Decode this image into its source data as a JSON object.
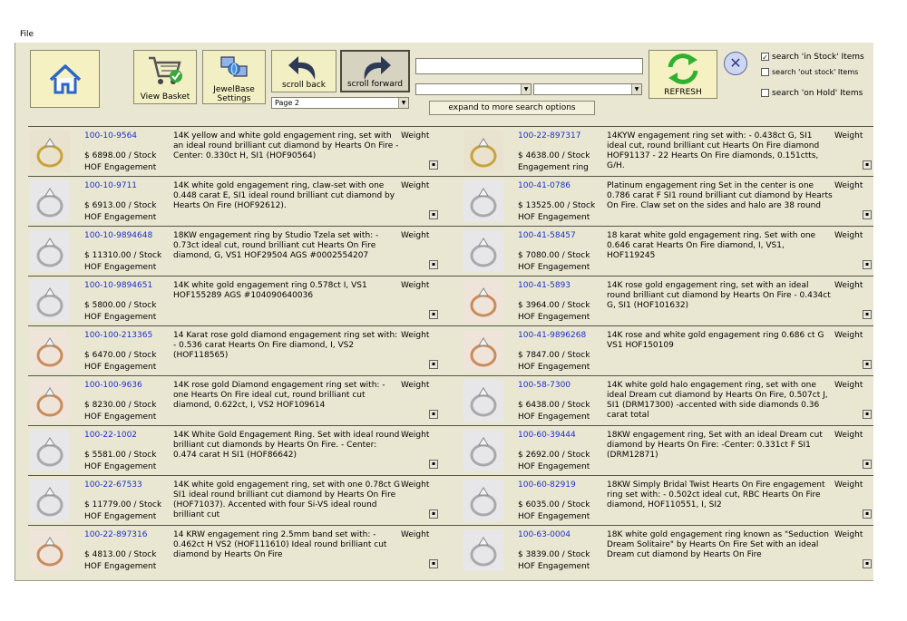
{
  "menu": {
    "file": "File"
  },
  "toolbar": {
    "view_basket": "View Basket",
    "jewelbase_settings": "JewelBase Settings",
    "scroll_back": "scroll back",
    "scroll_forward": "scroll forward",
    "page_select": "Page 2",
    "expand": "expand to more search options",
    "refresh": "REFRESH"
  },
  "checkboxes": [
    {
      "label": "search 'in Stock' Items",
      "checked": true
    },
    {
      "label": "search 'out stock' Items",
      "checked": false
    },
    {
      "label": "search 'on Hold' Items",
      "checked": false
    }
  ],
  "weight_label": "Weight",
  "rows": [
    [
      {
        "id": "100-10-9564",
        "price": "$ 6898.00 / Stock",
        "cat": "HOF Engagement",
        "desc": "14K yellow and white gold engagement ring, set with an ideal round brilliant cut diamond by Hearts On Fire -Center: 0.330ct H, SI1 (HOF90564)",
        "tone": "gold"
      },
      {
        "id": "100-22-897317",
        "price": "$ 4638.00 / Stock",
        "cat": "Engagement ring",
        "desc": "14KYW engagement ring set with: - 0.438ct G, SI1 ideal cut, round brilliant cut Hearts On Fire diamond HOF91137 - 22 Hearts On Fire diamonds, 0.151ctts, G/H,",
        "tone": "gold"
      }
    ],
    [
      {
        "id": "100-10-9711",
        "price": "$ 6913.00 / Stock",
        "cat": "HOF Engagement",
        "desc": "14K white gold engagement ring, claw-set with one 0.448 carat E, SI1 ideal round brilliant cut diamond by Hearts On Fire (HOF92612).",
        "tone": "white"
      },
      {
        "id": "100-41-0786",
        "price": "$ 13525.00 / Stock",
        "cat": "HOF Engagement",
        "desc": "Platinum engagement ring Set in the center is one 0.786 carat F SI1 round brilliant cut diamond by Hearts On Fire. Claw set on the sides and halo are 38 round",
        "tone": "white"
      }
    ],
    [
      {
        "id": "100-10-9894648",
        "price": "$ 11310.00 / Stock",
        "cat": "HOF Engagement",
        "desc": "18KW engagement ring by Studio Tzela set with: - 0.73ct ideal cut, round brilliant cut Hearts On Fire diamond, G, VS1 HOF29504 AGS #0002554207",
        "tone": "white"
      },
      {
        "id": "100-41-58457",
        "price": "$ 7080.00 / Stock",
        "cat": "HOF Engagement",
        "desc": "18 karat white gold engagement ring. Set with one 0.646 carat Hearts On Fire diamond, I, VS1, HOF119245",
        "tone": "white"
      }
    ],
    [
      {
        "id": "100-10-9894651",
        "price": "$ 5800.00 / Stock",
        "cat": "HOF Engagement",
        "desc": "14K white gold engagement ring 0.578ct I, VS1 HOF155289 AGS #104090640036",
        "tone": "white"
      },
      {
        "id": "100-41-5893",
        "price": "$ 3964.00 / Stock",
        "cat": "HOF Engagement",
        "desc": "14K rose gold engagement ring, set with an ideal round brilliant cut diamond by Hearts On Fire - 0.434ct G, SI1 (HOF101632)",
        "tone": "rose"
      }
    ],
    [
      {
        "id": "100-100-213365",
        "price": "$ 6470.00 / Stock",
        "cat": "HOF Engagement",
        "desc": "14 Karat rose gold diamond engagement ring set with: - 0.536 carat Hearts On Fire diamond, I, VS2 (HOF118565)",
        "tone": "rose"
      },
      {
        "id": "100-41-9896268",
        "price": "$ 7847.00 / Stock",
        "cat": "HOF Engagement",
        "desc": "14K rose and white gold engagement ring 0.686 ct G VS1 HOF150109",
        "tone": "rose"
      }
    ],
    [
      {
        "id": "100-100-9636",
        "price": "$ 8230.00 / Stock",
        "cat": "HOF Engagement",
        "desc": "14K rose gold Diamond engagement ring set with: - one Hearts On Fire ideal cut, round brilliant cut diamond, 0.622ct, I, VS2 HOF109614",
        "tone": "rose"
      },
      {
        "id": "100-58-7300",
        "price": "$ 6438.00 / Stock",
        "cat": "HOF Engagement",
        "desc": "14K white gold halo engagement ring, set with one ideal Dream cut diamond by Hearts On Fire, 0.507ct J, SI1 (DRM17300) -accented with side diamonds 0.36 carat total",
        "tone": "white"
      }
    ],
    [
      {
        "id": "100-22-1002",
        "price": "$ 5581.00 / Stock",
        "cat": "HOF Engagement",
        "desc": "14K White Gold Engagement Ring. Set with ideal round brilliant cut diamonds by Hearts On Fire. - Center: 0.474 carat H SI1 (HOF86642)",
        "tone": "white"
      },
      {
        "id": "100-60-39444",
        "price": "$ 2692.00 / Stock",
        "cat": "HOF Engagement",
        "desc": "18KW engagement ring, Set with an ideal Dream cut diamond by Hearts On Fire: -Center: 0.331ct F SI1 (DRM12871)",
        "tone": "white"
      }
    ],
    [
      {
        "id": "100-22-67533",
        "price": "$ 11779.00 / Stock",
        "cat": "HOF Engagement",
        "desc": "14K white gold engagement ring, set with one 0.78ct G SI1 ideal round brilliant cut diamond by Hearts On Fire (HOF71037). Accented with four Si-VS ideal round brilliant cut",
        "tone": "white"
      },
      {
        "id": "100-60-82919",
        "price": "$ 6035.00 / Stock",
        "cat": "HOF Engagement",
        "desc": "18KW Simply Bridal Twist Hearts On Fire engagement ring set with: - 0.502ct ideal cut, RBC Hearts On Fire diamond, HOF110551, I, SI2",
        "tone": "white"
      }
    ],
    [
      {
        "id": "100-22-897316",
        "price": "$ 4813.00 / Stock",
        "cat": "HOF Engagement",
        "desc": "14 KRW engagement ring 2.5mm band set with: - 0.462ct H VS2 (HOF111610) Ideal round brilliant cut diamond by Hearts On Fire",
        "tone": "rose"
      },
      {
        "id": "100-63-0004",
        "price": "$ 3839.00 / Stock",
        "cat": "HOF Engagement",
        "desc": "18K white gold engagement ring known as \"Seduction Dream Solitaire\" by Hearts On Fire Set with an ideal Dream cut diamond by Hearts On Fire",
        "tone": "white"
      }
    ]
  ]
}
